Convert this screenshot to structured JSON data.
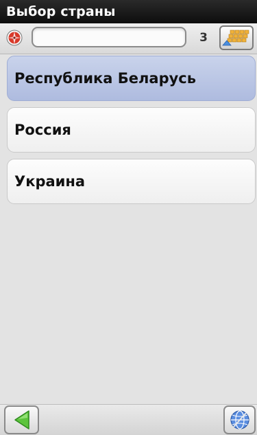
{
  "header": {
    "title": "Выбор страны"
  },
  "search": {
    "value": "",
    "placeholder": "",
    "result_count": "3"
  },
  "countries": [
    {
      "label": "Республика Беларусь",
      "selected": true
    },
    {
      "label": "Россия",
      "selected": false
    },
    {
      "label": "Украина",
      "selected": false
    }
  ],
  "icons": {
    "compass": "compass-icon",
    "keyboard": "keyboard-icon",
    "back": "back-arrow-icon",
    "globe": "globe-icon"
  },
  "colors": {
    "title_bar": "#111111",
    "selected_item": "#b8c4e4",
    "back_arrow": "#5cc43c",
    "compass": "#d83a2a",
    "keyboard_keys": "#f0b23a"
  }
}
